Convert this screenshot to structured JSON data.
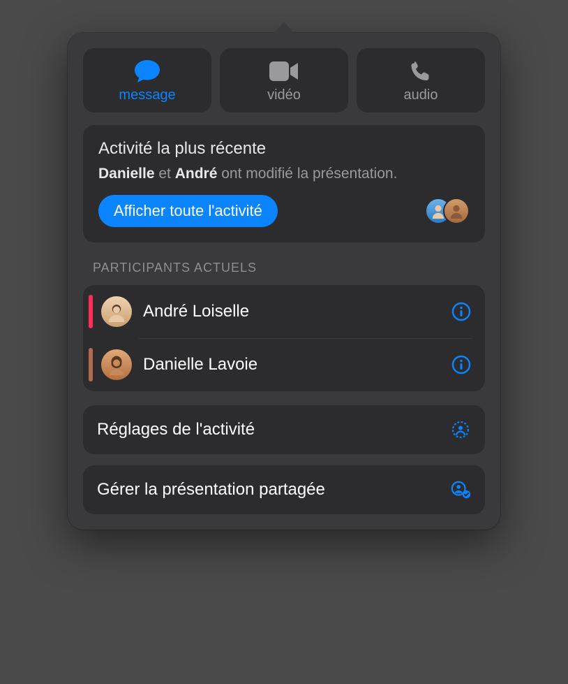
{
  "actions": {
    "message": {
      "label": "message",
      "active": true
    },
    "video": {
      "label": "vidéo",
      "active": false
    },
    "audio": {
      "label": "audio",
      "active": false
    }
  },
  "recent_activity": {
    "title": "Activité la plus récente",
    "subject1": "Danielle",
    "connector": " et ",
    "subject2": "André",
    "rest": " ont modifié la présentation.",
    "show_all_label": "Afficher toute l'activité"
  },
  "participants": {
    "heading": "PARTICIPANTS ACTUELS",
    "items": [
      {
        "name": "André Loiselle",
        "color": "#ff2d55",
        "avatar_bg": "#d9b38c",
        "avatar_txt": "🧑🏻"
      },
      {
        "name": "Danielle Lavoie",
        "color": "#b06a4e",
        "avatar_bg": "#d49a6a",
        "avatar_txt": "👩🏽"
      }
    ]
  },
  "settings": {
    "activity_settings": "Réglages de l'activité",
    "manage_shared": "Gérer la présentation partagée"
  },
  "colors": {
    "accent": "#0a84ff"
  }
}
